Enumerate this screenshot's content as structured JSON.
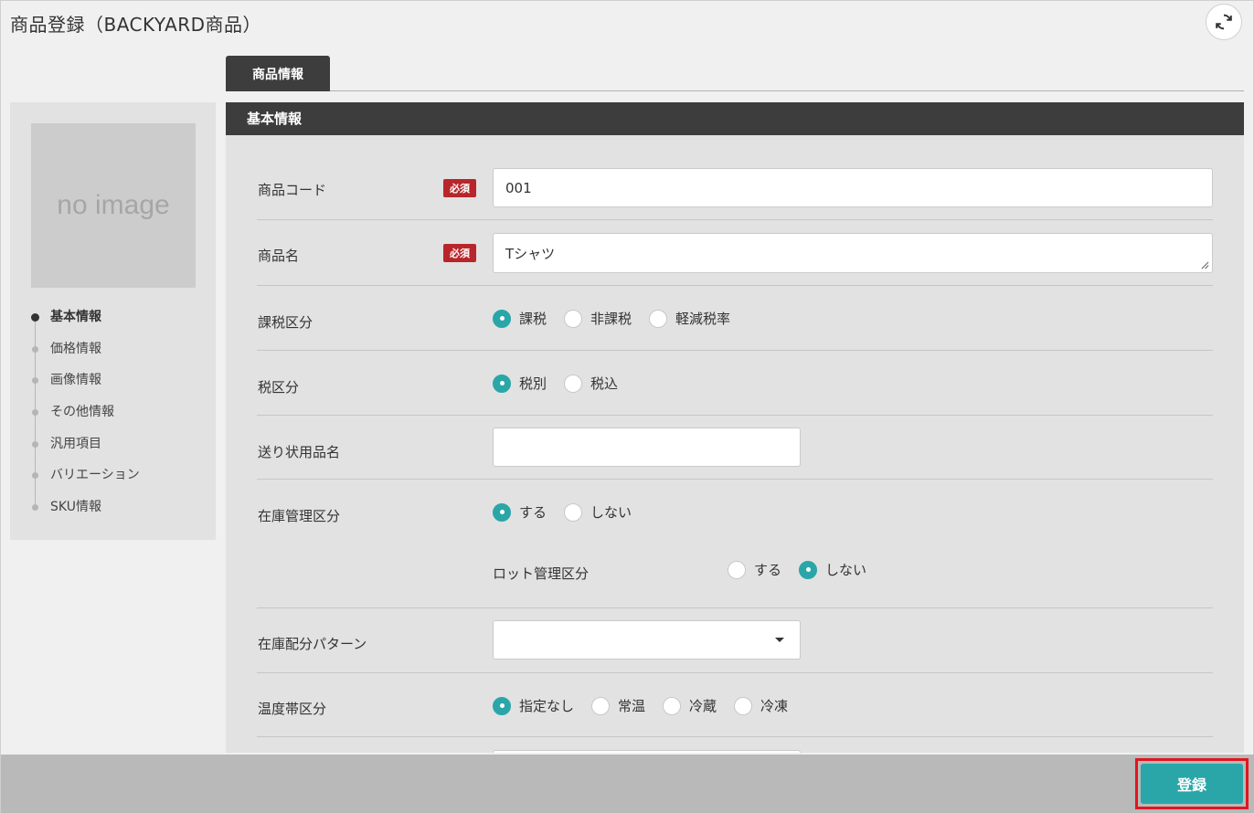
{
  "page": {
    "title": "商品登録（BACKYARD商品）"
  },
  "header": {
    "refresh_icon": "refresh-icon"
  },
  "sidebar": {
    "image_placeholder": "no image",
    "nav": [
      {
        "label": "基本情報",
        "active": true
      },
      {
        "label": "価格情報",
        "active": false
      },
      {
        "label": "画像情報",
        "active": false
      },
      {
        "label": "その他情報",
        "active": false
      },
      {
        "label": "汎用項目",
        "active": false
      },
      {
        "label": "バリエーション",
        "active": false
      },
      {
        "label": "SKU情報",
        "active": false
      }
    ]
  },
  "tabs": [
    {
      "label": "商品情報",
      "active": true
    }
  ],
  "section": {
    "title": "基本情報"
  },
  "form": {
    "required_badge": "必須",
    "product_code": {
      "label": "商品コード",
      "value": "001"
    },
    "product_name": {
      "label": "商品名",
      "value": "Tシャツ"
    },
    "tax_class": {
      "label": "課税区分",
      "options": [
        "課税",
        "非課税",
        "軽減税率"
      ],
      "selected": "課税"
    },
    "tax_type": {
      "label": "税区分",
      "options": [
        "税別",
        "税込"
      ],
      "selected": "税別"
    },
    "shipping_name": {
      "label": "送り状用品名",
      "value": ""
    },
    "stock_mgmt": {
      "label": "在庫管理区分",
      "options": [
        "する",
        "しない"
      ],
      "selected": "する"
    },
    "lot_mgmt": {
      "label": "ロット管理区分",
      "options": [
        "する",
        "しない"
      ],
      "selected": "しない"
    },
    "stock_pattern": {
      "label": "在庫配分パターン",
      "value": ""
    },
    "temperature": {
      "label": "温度帯区分",
      "options": [
        "指定なし",
        "常温",
        "冷蔵",
        "冷凍"
      ],
      "selected": "指定なし"
    }
  },
  "footer": {
    "submit_label": "登録"
  },
  "colors": {
    "accent": "#2aa6a9",
    "required": "#b8262b",
    "dark": "#3d3d3d",
    "highlight": "#e0161f"
  }
}
